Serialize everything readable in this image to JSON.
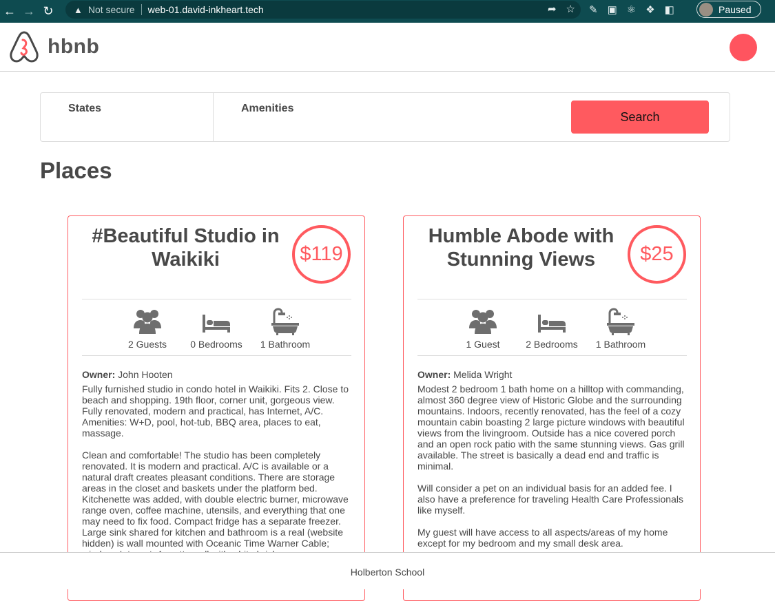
{
  "browser": {
    "security_label": "Not secure",
    "url": "web-01.david-inkheart.tech",
    "profile_status": "Paused"
  },
  "header": {
    "logo_text": "hbnb",
    "accent_color": "#ff545f"
  },
  "filters": {
    "states_label": "States",
    "amenities_label": "Amenities",
    "search_label": "Search"
  },
  "places_title": "Places",
  "places": [
    {
      "name": "#Beautiful Studio in Waikiki",
      "price": "$119",
      "guests": "2 Guests",
      "bedrooms": "0 Bedrooms",
      "bathrooms": "1 Bathroom",
      "owner_label": "Owner:",
      "owner": "John Hooten",
      "description": [
        "Fully furnished studio in condo hotel in Waikiki. Fits 2. Close to beach and shopping. 19th floor, corner unit, gorgeous view. Fully renovated, modern and practical, has Internet, A/C. Amenities: W+D, pool, hot-tub, BBQ area, places to eat, massage.",
        "Clean and comfortable! The studio has been completely renovated. It is modern and practical. A/C is available or a natural draft creates pleasant conditions. There are storage areas in the closet and baskets under the platform bed. Kitchenette was added, with double electric burner, microwave range oven, coffee machine, utensils, and everything that one may need to fix food. Compact fridge has a separate freezer. Large sink shared for kitchen and bathroom is a real (website hidden) is wall mounted with Oceanic Time Warner Cable; wireless Internet. A pretty wall with white brick"
      ]
    },
    {
      "name": "Humble Abode with Stunning Views",
      "price": "$25",
      "guests": "1 Guest",
      "bedrooms": "2 Bedrooms",
      "bathrooms": "1 Bathroom",
      "owner_label": "Owner:",
      "owner": "Melida Wright",
      "description": [
        "Modest 2 bedroom 1 bath home on a hilltop with commanding, almost 360 degree view of Historic Globe and the surrounding mountains. Indoors, recently renovated, has the feel of a cozy mountain cabin boasting 2 large picture windows with beautiful views from the livingroom. Outside has a nice covered porch and an open rock patio with the same stunning views. Gas grill available. The street is basically a dead end and traffic is minimal.",
        "Will consider a pet on an individual basis for an added fee. I also have a preference for traveling Health Care Professionals like myself.",
        "My guest will have access to all aspects/areas of my home except for my bedroom and my small desk area."
      ]
    }
  ],
  "footer_text": "Holberton School"
}
